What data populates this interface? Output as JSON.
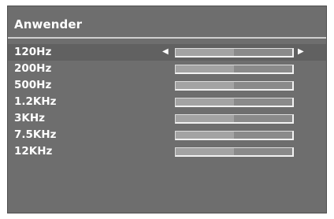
{
  "header": {
    "title": "Anwender"
  },
  "icons": {
    "left": "◀",
    "right": "▶"
  },
  "equalizer": {
    "selected_index": 0,
    "bands": [
      {
        "label": "120Hz",
        "level": 0.5
      },
      {
        "label": "200Hz",
        "level": 0.5
      },
      {
        "label": "500Hz",
        "level": 0.5
      },
      {
        "label": "1.2KHz",
        "level": 0.5
      },
      {
        "label": "3KHz",
        "level": 0.5
      },
      {
        "label": "7.5KHz",
        "level": 0.5
      },
      {
        "label": "12KHz",
        "level": 0.5
      }
    ]
  }
}
